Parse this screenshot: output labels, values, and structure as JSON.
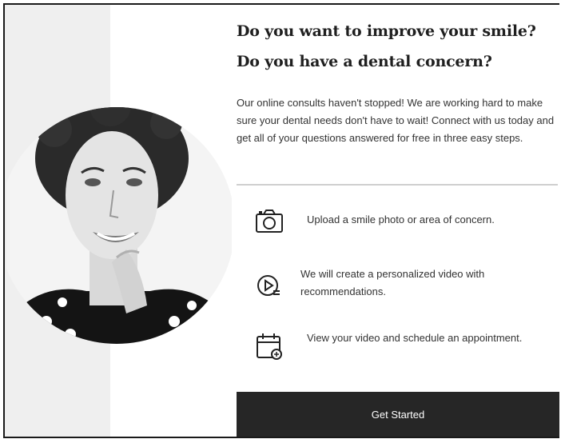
{
  "heading": {
    "line1": "Do you want to improve your smile?",
    "line2": "Do you have a dental concern?"
  },
  "intro": "Our online consults haven't stopped! We are working hard to make sure your dental needs don't have to wait! Connect with us today and get all of your questions answered for free in three easy steps.",
  "steps": [
    {
      "icon": "camera-icon",
      "text": "Upload a smile photo or area of concern."
    },
    {
      "icon": "play-video-icon",
      "text": "We will create a personalized video with recommendations."
    },
    {
      "icon": "calendar-icon",
      "text": "View your video and schedule an appointment."
    }
  ],
  "cta": {
    "label": "Get Started"
  },
  "colors": {
    "button_bg": "#262626",
    "button_text": "#ffffff",
    "left_panel": "#efefef"
  }
}
